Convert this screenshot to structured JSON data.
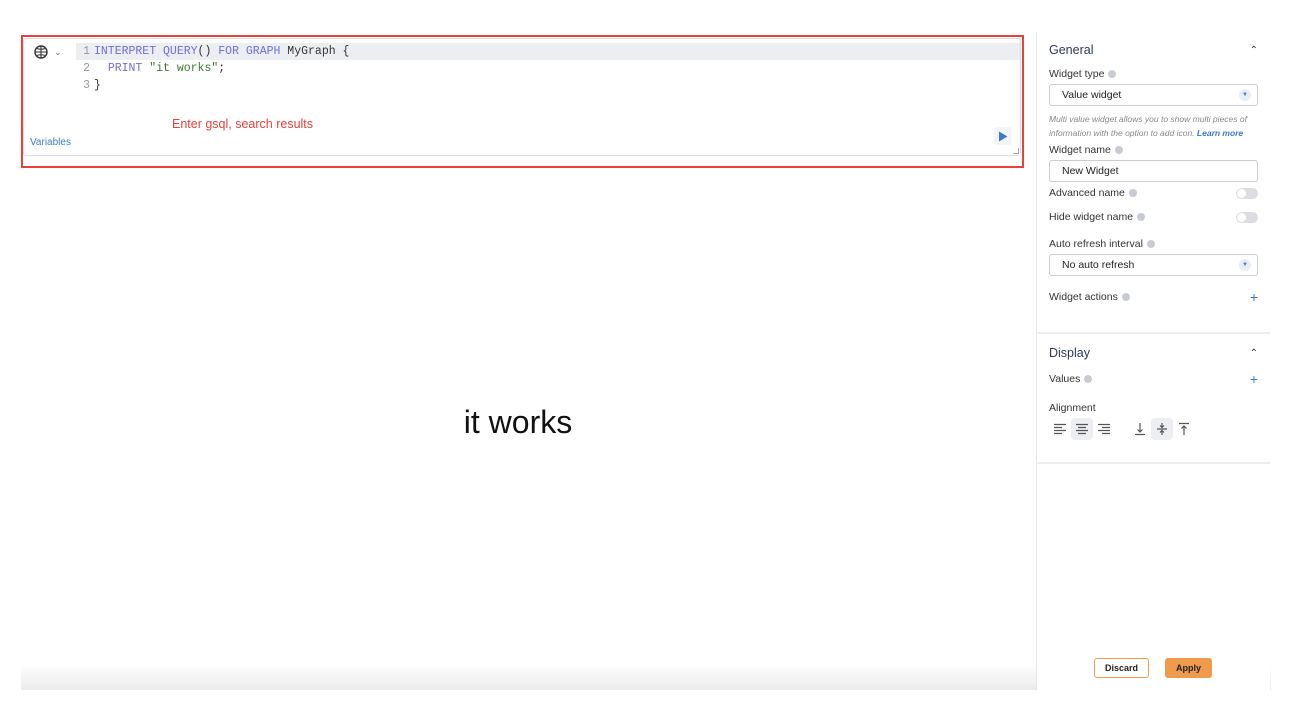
{
  "editor": {
    "lines": [
      {
        "num": "1",
        "tokens": [
          {
            "t": "INTERPRET",
            "c": "kw"
          },
          {
            "t": " ",
            "c": "plain"
          },
          {
            "t": "QUERY",
            "c": "kw"
          },
          {
            "t": "() ",
            "c": "plain"
          },
          {
            "t": "FOR",
            "c": "kw"
          },
          {
            "t": " ",
            "c": "plain"
          },
          {
            "t": "GRAPH",
            "c": "kw"
          },
          {
            "t": " MyGraph {",
            "c": "plain"
          }
        ]
      },
      {
        "num": "2",
        "tokens": [
          {
            "t": "  ",
            "c": "plain"
          },
          {
            "t": "PRINT",
            "c": "kw"
          },
          {
            "t": " ",
            "c": "plain"
          },
          {
            "t": "\"it works\"",
            "c": "str"
          },
          {
            "t": ";",
            "c": "plain"
          }
        ]
      },
      {
        "num": "3",
        "tokens": [
          {
            "t": "}",
            "c": "plain"
          }
        ]
      }
    ],
    "variables_link": "Variables",
    "graph_icon": "globe-icon",
    "run_icon": "play-icon"
  },
  "annotation": "Enter gsql, search results",
  "output": {
    "value": "it works"
  },
  "sidebar": {
    "general": {
      "title": "General",
      "widget_type_label": "Widget type",
      "widget_type_value": "Value widget",
      "hint": "Multi value widget allows you to show multi pieces of information with the option to add icon.",
      "learn_more": "Learn more",
      "widget_name_label": "Widget name",
      "widget_name_value": "New Widget",
      "advanced_name_label": "Advanced name",
      "advanced_name_on": false,
      "hide_widget_name_label": "Hide widget name",
      "hide_widget_name_on": false,
      "auto_refresh_label": "Auto refresh interval",
      "auto_refresh_value": "No auto refresh",
      "widget_actions_label": "Widget actions"
    },
    "display": {
      "title": "Display",
      "values_label": "Values",
      "alignment_label": "Alignment",
      "horizontal_selected": "center",
      "vertical_selected": "middle"
    }
  },
  "footer": {
    "discard": "Discard",
    "apply": "Apply"
  },
  "colors": {
    "accent": "#ef9a4c",
    "link": "#3d7ac9",
    "annotation": "#e8403a",
    "keyword": "#6e6ee0",
    "string": "#3c7a2a"
  }
}
